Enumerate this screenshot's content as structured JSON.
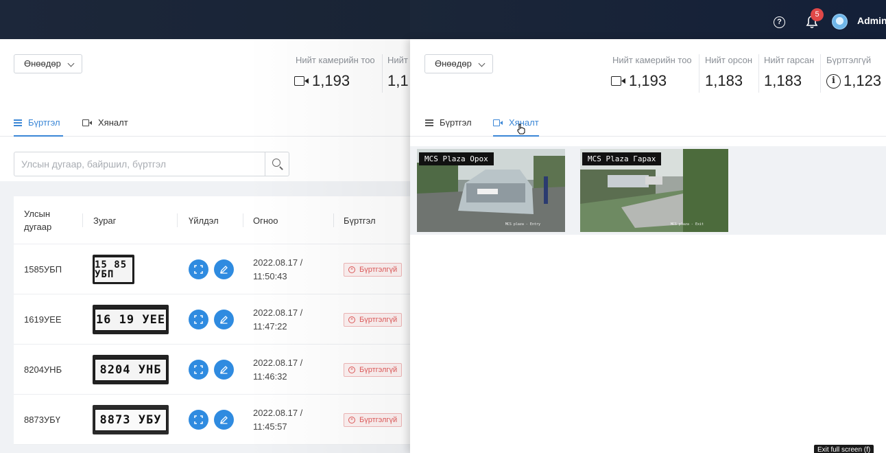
{
  "topbar": {
    "notification_count": "5",
    "user_name": "Admin"
  },
  "left": {
    "filter": {
      "selected": "Өнөөдөр"
    },
    "stats": [
      {
        "label": "Нийт камерийн тоо",
        "value": "1,193"
      },
      {
        "label": "Нийт",
        "value": "1,1"
      }
    ],
    "tabs": [
      {
        "label": "Бүртгэл",
        "active": true
      },
      {
        "label": "Хяналт",
        "active": false
      }
    ],
    "search": {
      "placeholder": "Улсын дугаар, байршил, бүртгэл"
    },
    "table": {
      "headers": {
        "plate_line1": "Улсын",
        "plate_line2": "дугаар",
        "image": "Зураг",
        "action": "Үйлдэл",
        "date": "Огноо",
        "registration": "Бүртгэл"
      },
      "rows": [
        {
          "plate": "1585УБП",
          "plate_img": "15 85 УБП",
          "date": "2022.08.17 /",
          "time": "11:50:43",
          "status": "Бүртгэлгүй"
        },
        {
          "plate": "1619УЕЕ",
          "plate_img": "16 19 УЕЕ",
          "date": "2022.08.17 /",
          "time": "11:47:22",
          "status": "Бүртгэлгүй"
        },
        {
          "plate": "8204УНБ",
          "plate_img": "8204 УНБ",
          "date": "2022.08.17 /",
          "time": "11:46:32",
          "status": "Бүртгэлгүй"
        },
        {
          "plate": "8873УБҮ",
          "plate_img": "8873 УБУ",
          "date": "2022.08.17 /",
          "time": "11:45:57",
          "status": "Бүртгэлгүй"
        }
      ]
    }
  },
  "right": {
    "filter": {
      "selected": "Өнөөдөр"
    },
    "stats": [
      {
        "label": "Нийт камерийн тоо",
        "value": "1,193",
        "icon": "camera-icon"
      },
      {
        "label": "Нийт орсон",
        "value": "1,183"
      },
      {
        "label": "Нийт гарсан",
        "value": "1,183"
      },
      {
        "label": "Бүртгэлгүй",
        "value": "1,123",
        "icon": "info-icon"
      }
    ],
    "tabs": [
      {
        "label": "Бүртгэл",
        "active": false
      },
      {
        "label": "Хяналт",
        "active": true
      }
    ],
    "cameras": [
      {
        "label": "MCS Plaza Орох",
        "footer": "MCS plaza - Entry"
      },
      {
        "label": "MCS Plaza Гарах",
        "footer": "MCS plaza - Exit"
      }
    ]
  },
  "overlay": {
    "exit_fullscreen": "Exit full screen (f)"
  },
  "colors": {
    "accent": "#3a86d6",
    "topbar": "#1e2a3e",
    "danger": "#e05a5a",
    "action_button": "#2f8be0"
  }
}
